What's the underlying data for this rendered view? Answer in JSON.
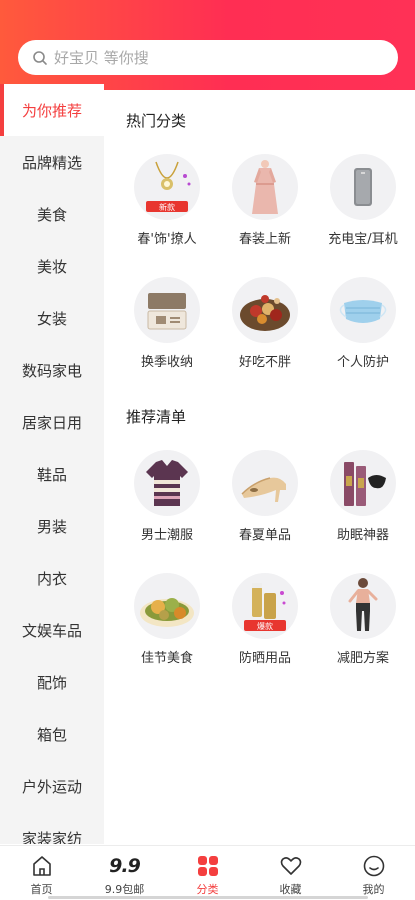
{
  "search": {
    "placeholder": "好宝贝 等你搜"
  },
  "sidebar": {
    "items": [
      {
        "label": "为你推荐"
      },
      {
        "label": "品牌精选"
      },
      {
        "label": "美食"
      },
      {
        "label": "美妆"
      },
      {
        "label": "女装"
      },
      {
        "label": "数码家电"
      },
      {
        "label": "居家日用"
      },
      {
        "label": "鞋品"
      },
      {
        "label": "男装"
      },
      {
        "label": "内衣"
      },
      {
        "label": "文娱车品"
      },
      {
        "label": "配饰"
      },
      {
        "label": "箱包"
      },
      {
        "label": "户外运动"
      },
      {
        "label": "家装家纺"
      }
    ]
  },
  "sections": [
    {
      "title": "热门分类",
      "items": [
        {
          "label": "春'饰'撩人",
          "badge": "新款",
          "icon": "necklace-icon"
        },
        {
          "label": "春装上新",
          "icon": "dress-icon"
        },
        {
          "label": "充电宝/耳机",
          "icon": "powerbank-icon"
        },
        {
          "label": "换季收纳",
          "icon": "storage-box-icon"
        },
        {
          "label": "好吃不胖",
          "icon": "snack-bowl-icon"
        },
        {
          "label": "个人防护",
          "icon": "face-mask-icon"
        }
      ]
    },
    {
      "title": "推荐清单",
      "items": [
        {
          "label": "男士潮服",
          "icon": "polo-shirt-icon"
        },
        {
          "label": "春夏单品",
          "icon": "heels-icon"
        },
        {
          "label": "助眠神器",
          "icon": "sleep-kit-icon"
        },
        {
          "label": "佳节美食",
          "icon": "rice-cakes-icon"
        },
        {
          "label": "防晒用品",
          "badge": "爆款",
          "icon": "sunscreen-icon"
        },
        {
          "label": "减肥方案",
          "icon": "fitness-woman-icon"
        }
      ]
    }
  ],
  "tabbar": {
    "items": [
      {
        "label": "首页",
        "icon": "home-icon"
      },
      {
        "label": "9.9包邮",
        "icon_text": "9.9",
        "icon": "nine-nine-icon"
      },
      {
        "label": "分类",
        "icon": "category-icon"
      },
      {
        "label": "收藏",
        "icon": "heart-icon"
      },
      {
        "label": "我的",
        "icon": "profile-smile-icon"
      }
    ]
  },
  "colors": {
    "accent": "#f43f3f",
    "header_start": "#ff5a3c",
    "header_end": "#ff3156"
  }
}
